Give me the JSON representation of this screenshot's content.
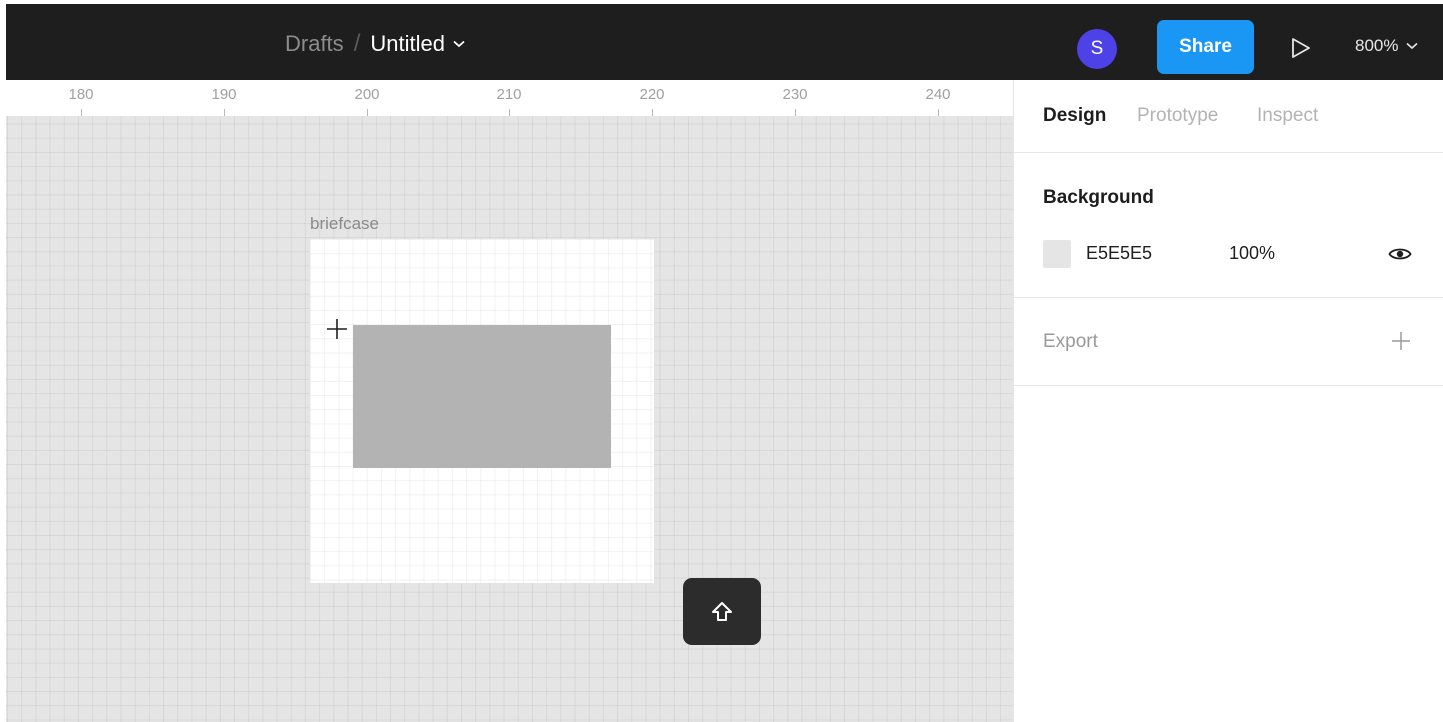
{
  "header": {
    "breadcrumb_parent": "Drafts",
    "separator": "/",
    "file_name": "Untitled",
    "avatar_initial": "S",
    "share_label": "Share",
    "zoom_level": "800%",
    "colors": {
      "bar": "#1e1e1e",
      "share": "#1a97f5",
      "avatar": "#4c42e8"
    }
  },
  "canvas": {
    "ruler_ticks": [
      "180",
      "190",
      "200",
      "210",
      "220",
      "230",
      "240"
    ],
    "frame_label": "briefcase",
    "background_color": "#e5e5e5"
  },
  "panel": {
    "tabs": [
      {
        "label": "Design",
        "active": true
      },
      {
        "label": "Prototype",
        "active": false
      },
      {
        "label": "Inspect",
        "active": false
      }
    ],
    "background": {
      "title": "Background",
      "hex": "E5E5E5",
      "opacity": "100%",
      "visible_icon": "eye-icon"
    },
    "export": {
      "title": "Export",
      "add_icon": "plus-icon"
    }
  }
}
